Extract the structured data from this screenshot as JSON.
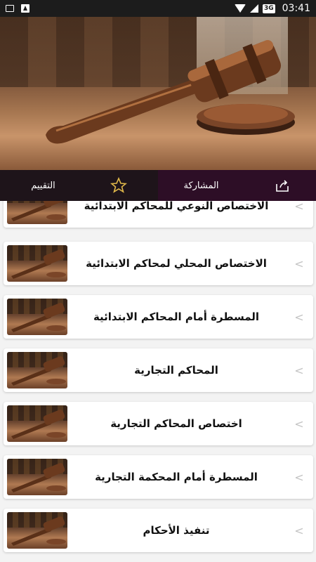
{
  "status_bar": {
    "time": "03:41",
    "battery": "3G"
  },
  "header": {
    "image": "gavel-photo"
  },
  "tabs": {
    "share_label": "المشاركة",
    "rate_label": "التقييم",
    "share_icon": "share-icon",
    "rate_icon": "star-icon"
  },
  "list": {
    "items": [
      {
        "title": "الاختصاص النوعي للمحاكم الابتدائية"
      },
      {
        "title": "الاختصاص المحلي لمحاكم الابتدائية"
      },
      {
        "title": "المسطرة أمام المحاكم الابتدائية"
      },
      {
        "title": "المحاكم التجارية"
      },
      {
        "title": "اختصاص المحاكم التجارية"
      },
      {
        "title": "المسطرة أمام المحكمة التجارية"
      },
      {
        "title": "تنفيذ الأحكام"
      }
    ],
    "chevron": "<"
  },
  "colors": {
    "tab_bar": "#231019",
    "share_tab": "#2d0e26",
    "card_bg": "#ffffff"
  }
}
